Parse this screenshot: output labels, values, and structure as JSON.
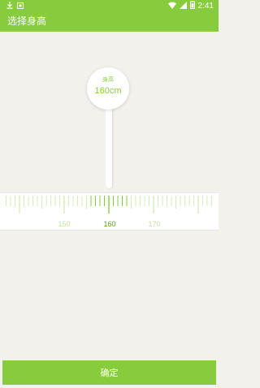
{
  "status_bar": {
    "time": "2:41",
    "left_icons": [
      "download-icon",
      "notification-icon"
    ],
    "right_icons": [
      "wifi-icon",
      "signal-icon",
      "battery-icon"
    ]
  },
  "app_bar": {
    "title": "选择身高"
  },
  "height_picker": {
    "label": "身高",
    "value_text": "160cm",
    "selected_value": 160,
    "scale_labels": [
      "150",
      "160",
      "170"
    ]
  },
  "confirm_button": {
    "label": "确定"
  },
  "colors": {
    "accent": "#87cc3c",
    "background": "#f3f1ec",
    "tick_light": "#d5ecbd",
    "tick_active": "#87cc3c"
  }
}
